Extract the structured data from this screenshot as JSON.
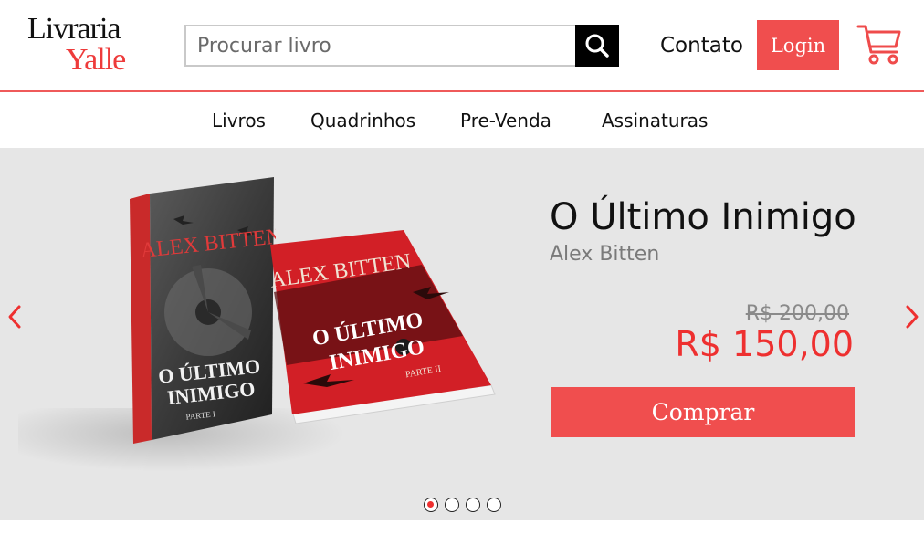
{
  "header": {
    "logo_line1": "Livraria",
    "logo_line2": "Yalle",
    "search_placeholder": "Procurar livro",
    "search_icon": "search-icon",
    "contato_label": "Contato",
    "login_label": "Login",
    "cart_icon": "cart-icon"
  },
  "nav": {
    "items": [
      {
        "label": "Livros"
      },
      {
        "label": "Quadrinhos"
      },
      {
        "label": "Pre-Venda"
      },
      {
        "label": "Assinaturas"
      }
    ]
  },
  "banner": {
    "title": "O Último Inimigo",
    "author": "Alex Bitten",
    "old_price": "R$ 200,00",
    "new_price": "R$ 150,00",
    "buy_label": "Comprar",
    "book1": {
      "author": "ALEX BITTEN",
      "title_line1": "O ÚLTIMO",
      "title_line2": "INIMIGO",
      "part": "PARTE I"
    },
    "book2": {
      "author": "ALEX BITTEN",
      "title_line1": "O ÚLTIMO",
      "title_line2": "INIMIGO",
      "part": "PARTE II"
    },
    "slides_total": 4,
    "active_slide": 1
  },
  "colors": {
    "accent": "#f04e4e",
    "price": "#ee3030",
    "banner_bg": "#e6e6e6",
    "header_border": "#ef5a5a"
  }
}
